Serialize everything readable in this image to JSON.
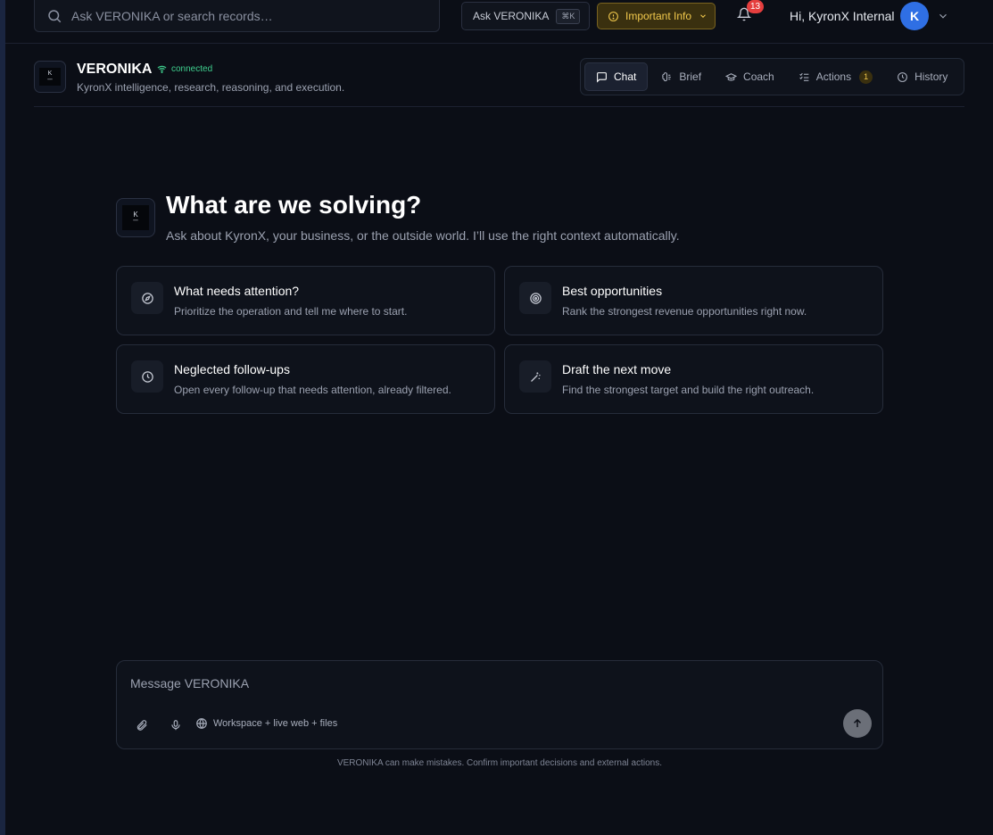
{
  "topbar": {
    "search_placeholder": "Ask VERONIKA or search records…",
    "ask_label": "Ask VERONIKA",
    "ask_shortcut": "⌘K",
    "info_label": "Important Info",
    "notification_count": "13",
    "greeting": "Hi, KyronX Internal",
    "avatar_initial": "K"
  },
  "header": {
    "title": "VERONIKA",
    "status": "connected",
    "subtitle": "KyronX intelligence, research, reasoning, and execution.",
    "logo_text": "K",
    "tabs": [
      {
        "label": "Chat",
        "icon": "chat-icon",
        "active": true
      },
      {
        "label": "Brief",
        "icon": "brief-icon"
      },
      {
        "label": "Coach",
        "icon": "coach-icon"
      },
      {
        "label": "Actions",
        "icon": "actions-icon",
        "count": "1"
      },
      {
        "label": "History",
        "icon": "history-icon"
      }
    ]
  },
  "hero": {
    "title": "What are we solving?",
    "subtitle": "Ask about KyronX, your business, or the outside world. I’ll use the right context automatically."
  },
  "cards": [
    {
      "title": "What needs attention?",
      "desc": "Prioritize the operation and tell me where to start.",
      "icon": "compass-icon"
    },
    {
      "title": "Best opportunities",
      "desc": "Rank the strongest revenue opportunities right now.",
      "icon": "target-icon"
    },
    {
      "title": "Neglected follow-ups",
      "desc": "Open every follow-up that needs attention, already filtered.",
      "icon": "clock-icon"
    },
    {
      "title": "Draft the next move",
      "desc": "Find the strongest target and build the right outreach.",
      "icon": "wand-icon"
    }
  ],
  "composer": {
    "placeholder": "Message VERONIKA",
    "context_label": "Workspace + live web + files",
    "disclaimer": "VERONIKA can make mistakes. Confirm important decisions and external actions."
  },
  "colors": {
    "background": "#0b0e16",
    "accent_blue": "#2f6fe4",
    "warning": "#f2c94c",
    "success": "#3fcf8e",
    "badge_red": "#e53e3e"
  }
}
